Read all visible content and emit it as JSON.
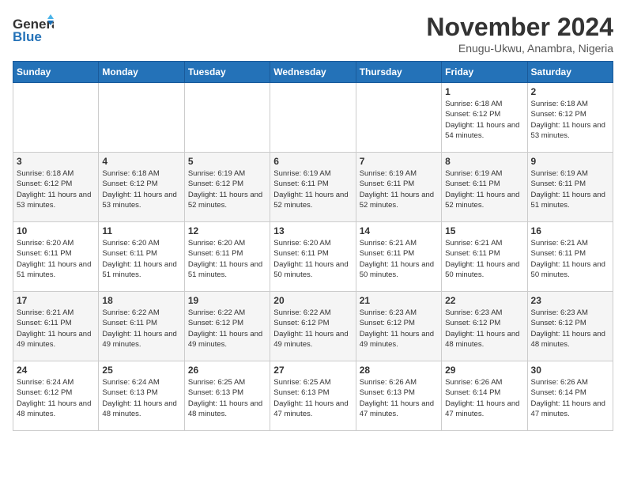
{
  "header": {
    "logo_general": "General",
    "logo_blue": "Blue",
    "month": "November 2024",
    "location": "Enugu-Ukwu, Anambra, Nigeria"
  },
  "weekdays": [
    "Sunday",
    "Monday",
    "Tuesday",
    "Wednesday",
    "Thursday",
    "Friday",
    "Saturday"
  ],
  "weeks": [
    [
      {
        "day": "",
        "info": ""
      },
      {
        "day": "",
        "info": ""
      },
      {
        "day": "",
        "info": ""
      },
      {
        "day": "",
        "info": ""
      },
      {
        "day": "",
        "info": ""
      },
      {
        "day": "1",
        "info": "Sunrise: 6:18 AM\nSunset: 6:12 PM\nDaylight: 11 hours\nand 54 minutes."
      },
      {
        "day": "2",
        "info": "Sunrise: 6:18 AM\nSunset: 6:12 PM\nDaylight: 11 hours\nand 53 minutes."
      }
    ],
    [
      {
        "day": "3",
        "info": "Sunrise: 6:18 AM\nSunset: 6:12 PM\nDaylight: 11 hours\nand 53 minutes."
      },
      {
        "day": "4",
        "info": "Sunrise: 6:18 AM\nSunset: 6:12 PM\nDaylight: 11 hours\nand 53 minutes."
      },
      {
        "day": "5",
        "info": "Sunrise: 6:19 AM\nSunset: 6:12 PM\nDaylight: 11 hours\nand 52 minutes."
      },
      {
        "day": "6",
        "info": "Sunrise: 6:19 AM\nSunset: 6:11 PM\nDaylight: 11 hours\nand 52 minutes."
      },
      {
        "day": "7",
        "info": "Sunrise: 6:19 AM\nSunset: 6:11 PM\nDaylight: 11 hours\nand 52 minutes."
      },
      {
        "day": "8",
        "info": "Sunrise: 6:19 AM\nSunset: 6:11 PM\nDaylight: 11 hours\nand 52 minutes."
      },
      {
        "day": "9",
        "info": "Sunrise: 6:19 AM\nSunset: 6:11 PM\nDaylight: 11 hours\nand 51 minutes."
      }
    ],
    [
      {
        "day": "10",
        "info": "Sunrise: 6:20 AM\nSunset: 6:11 PM\nDaylight: 11 hours\nand 51 minutes."
      },
      {
        "day": "11",
        "info": "Sunrise: 6:20 AM\nSunset: 6:11 PM\nDaylight: 11 hours\nand 51 minutes."
      },
      {
        "day": "12",
        "info": "Sunrise: 6:20 AM\nSunset: 6:11 PM\nDaylight: 11 hours\nand 51 minutes."
      },
      {
        "day": "13",
        "info": "Sunrise: 6:20 AM\nSunset: 6:11 PM\nDaylight: 11 hours\nand 50 minutes."
      },
      {
        "day": "14",
        "info": "Sunrise: 6:21 AM\nSunset: 6:11 PM\nDaylight: 11 hours\nand 50 minutes."
      },
      {
        "day": "15",
        "info": "Sunrise: 6:21 AM\nSunset: 6:11 PM\nDaylight: 11 hours\nand 50 minutes."
      },
      {
        "day": "16",
        "info": "Sunrise: 6:21 AM\nSunset: 6:11 PM\nDaylight: 11 hours\nand 50 minutes."
      }
    ],
    [
      {
        "day": "17",
        "info": "Sunrise: 6:21 AM\nSunset: 6:11 PM\nDaylight: 11 hours\nand 49 minutes."
      },
      {
        "day": "18",
        "info": "Sunrise: 6:22 AM\nSunset: 6:11 PM\nDaylight: 11 hours\nand 49 minutes."
      },
      {
        "day": "19",
        "info": "Sunrise: 6:22 AM\nSunset: 6:12 PM\nDaylight: 11 hours\nand 49 minutes."
      },
      {
        "day": "20",
        "info": "Sunrise: 6:22 AM\nSunset: 6:12 PM\nDaylight: 11 hours\nand 49 minutes."
      },
      {
        "day": "21",
        "info": "Sunrise: 6:23 AM\nSunset: 6:12 PM\nDaylight: 11 hours\nand 49 minutes."
      },
      {
        "day": "22",
        "info": "Sunrise: 6:23 AM\nSunset: 6:12 PM\nDaylight: 11 hours\nand 48 minutes."
      },
      {
        "day": "23",
        "info": "Sunrise: 6:23 AM\nSunset: 6:12 PM\nDaylight: 11 hours\nand 48 minutes."
      }
    ],
    [
      {
        "day": "24",
        "info": "Sunrise: 6:24 AM\nSunset: 6:12 PM\nDaylight: 11 hours\nand 48 minutes."
      },
      {
        "day": "25",
        "info": "Sunrise: 6:24 AM\nSunset: 6:13 PM\nDaylight: 11 hours\nand 48 minutes."
      },
      {
        "day": "26",
        "info": "Sunrise: 6:25 AM\nSunset: 6:13 PM\nDaylight: 11 hours\nand 48 minutes."
      },
      {
        "day": "27",
        "info": "Sunrise: 6:25 AM\nSunset: 6:13 PM\nDaylight: 11 hours\nand 47 minutes."
      },
      {
        "day": "28",
        "info": "Sunrise: 6:26 AM\nSunset: 6:13 PM\nDaylight: 11 hours\nand 47 minutes."
      },
      {
        "day": "29",
        "info": "Sunrise: 6:26 AM\nSunset: 6:14 PM\nDaylight: 11 hours\nand 47 minutes."
      },
      {
        "day": "30",
        "info": "Sunrise: 6:26 AM\nSunset: 6:14 PM\nDaylight: 11 hours\nand 47 minutes."
      }
    ]
  ]
}
